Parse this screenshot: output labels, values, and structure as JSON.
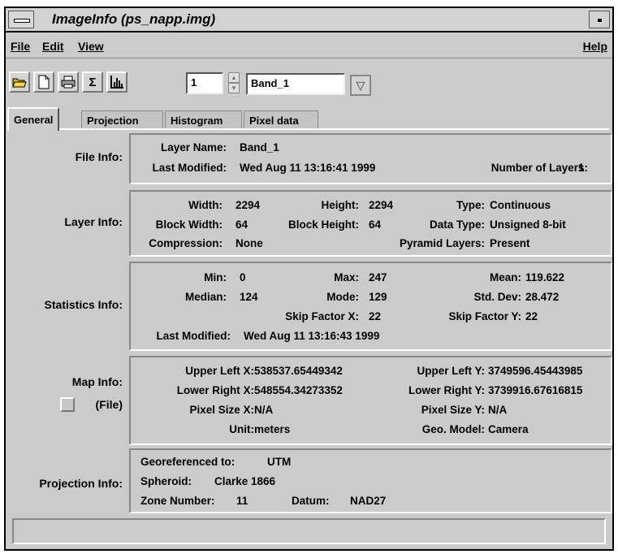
{
  "window": {
    "title": "ImageInfo (ps_napp.img)"
  },
  "menubar": {
    "file": "File",
    "edit": "Edit",
    "view": "View",
    "help": "Help"
  },
  "toolbar": {
    "icons": [
      "open-folder-icon",
      "new-document-icon",
      "print-icon",
      "sigma-icon",
      "histogram-icon"
    ],
    "layer_number": "1",
    "band_name": "Band_1"
  },
  "tabs": [
    "General",
    "Projection",
    "Histogram",
    "Pixel data"
  ],
  "active_tab": "General",
  "file_info": {
    "label": "File Info:",
    "layer_name_label": "Layer Name:",
    "layer_name": "Band_1",
    "last_modified_label": "Last Modified:",
    "last_modified": "Wed Aug 11 13:16:41 1999",
    "num_layers_label": "Number of Layers:",
    "num_layers": "1"
  },
  "layer_info": {
    "label": "Layer Info:",
    "width_label": "Width:",
    "width": "2294",
    "height_label": "Height:",
    "height": "2294",
    "type_label": "Type:",
    "type": "Continuous",
    "block_width_label": "Block Width:",
    "block_width": "64",
    "block_height_label": "Block Height:",
    "block_height": "64",
    "data_type_label": "Data Type:",
    "data_type": "Unsigned 8-bit",
    "compression_label": "Compression:",
    "compression": "None",
    "pyramid_label": "Pyramid Layers:",
    "pyramid": "Present"
  },
  "statistics_info": {
    "label": "Statistics Info:",
    "min_label": "Min:",
    "min": "0",
    "max_label": "Max:",
    "max": "247",
    "mean_label": "Mean:",
    "mean": "119.622",
    "median_label": "Median:",
    "median": "124",
    "mode_label": "Mode:",
    "mode": "129",
    "std_label": "Std. Dev:",
    "std": "28.472",
    "skip_x_label": "Skip Factor X:",
    "skip_x": "22",
    "skip_y_label": "Skip Factor Y:",
    "skip_y": "22",
    "last_modified_label": "Last Modified:",
    "last_modified": "Wed Aug 11 13:16:43 1999"
  },
  "map_info": {
    "label": "Map Info:",
    "file_label": "(File)",
    "ulx_label": "Upper Left X:",
    "ulx": "538537.65449342",
    "uly_label": "Upper Left Y:",
    "uly": "3749596.45443985",
    "lrx_label": "Lower Right X:",
    "lrx": "548554.34273352",
    "lry_label": "Lower Right Y:",
    "lry": "3739916.67616815",
    "psx_label": "Pixel Size X:",
    "psx": "N/A",
    "psy_label": "Pixel Size Y:",
    "psy": "N/A",
    "unit_label": "Unit:",
    "unit": "meters",
    "geo_model_label": "Geo. Model:",
    "geo_model": "Camera"
  },
  "projection_info": {
    "label": "Projection Info:",
    "georef_label": "Georeferenced to:",
    "georef": "UTM",
    "spheroid_label": "Spheroid:",
    "spheroid": "Clarke 1866",
    "zone_label": "Zone Number:",
    "zone": "11",
    "datum_label": "Datum:",
    "datum": "NAD27"
  },
  "status": {
    "text": ""
  }
}
